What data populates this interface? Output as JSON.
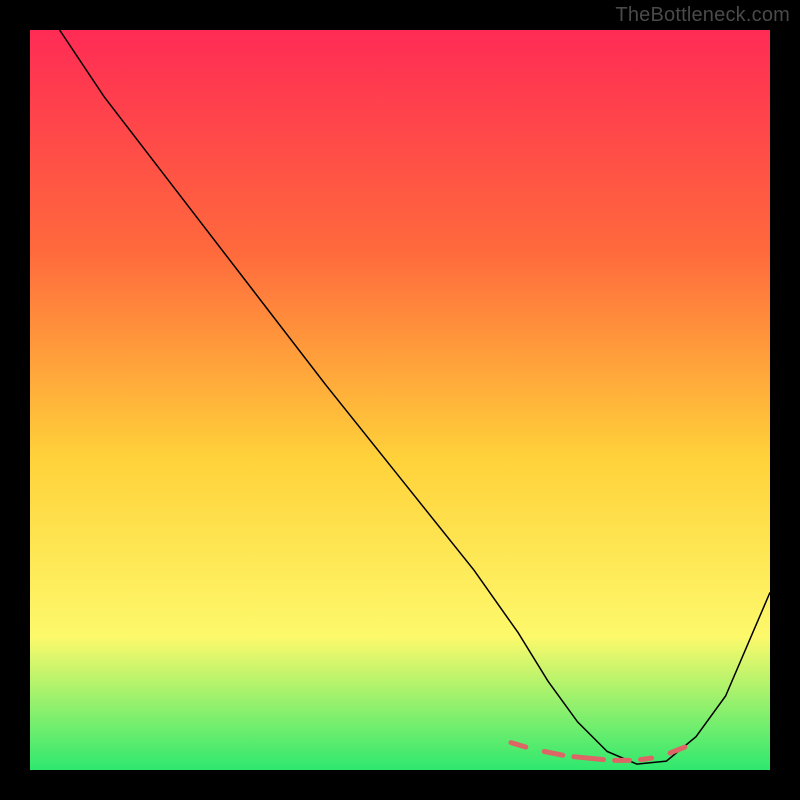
{
  "watermark": "TheBottleneck.com",
  "chart_data": {
    "type": "line",
    "title": "",
    "xlabel": "",
    "ylabel": "",
    "xlim": [
      0,
      100
    ],
    "ylim": [
      0,
      100
    ],
    "grid": false,
    "legend": false,
    "background_gradient": {
      "top": "#ff2b55",
      "mid1": "#ff6a3c",
      "mid2": "#ffd23a",
      "mid3": "#fdf96b",
      "bottom": "#2ee86f"
    },
    "series": [
      {
        "name": "bottleneck-curve",
        "color": "#000000",
        "stroke_width": 1.5,
        "x": [
          4,
          10,
          20,
          30,
          40,
          50,
          60,
          66,
          70,
          74,
          78,
          82,
          86,
          90,
          94,
          100
        ],
        "y": [
          100,
          91,
          78,
          65,
          52,
          39.5,
          27,
          18.5,
          12,
          6.5,
          2.5,
          0.8,
          1.2,
          4.5,
          10,
          24
        ]
      }
    ],
    "markers": {
      "name": "highlight-dashes",
      "color": "#dd6565",
      "stroke_width": 5,
      "segments": [
        {
          "x1": 65.0,
          "y1": 3.7,
          "x2": 67.0,
          "y2": 3.1
        },
        {
          "x1": 69.5,
          "y1": 2.5,
          "x2": 72.0,
          "y2": 2.0
        },
        {
          "x1": 73.5,
          "y1": 1.8,
          "x2": 77.5,
          "y2": 1.4
        },
        {
          "x1": 79.0,
          "y1": 1.3,
          "x2": 81.0,
          "y2": 1.3
        },
        {
          "x1": 82.5,
          "y1": 1.4,
          "x2": 84.0,
          "y2": 1.6
        },
        {
          "x1": 86.5,
          "y1": 2.3,
          "x2": 88.5,
          "y2": 3.1
        }
      ]
    }
  }
}
